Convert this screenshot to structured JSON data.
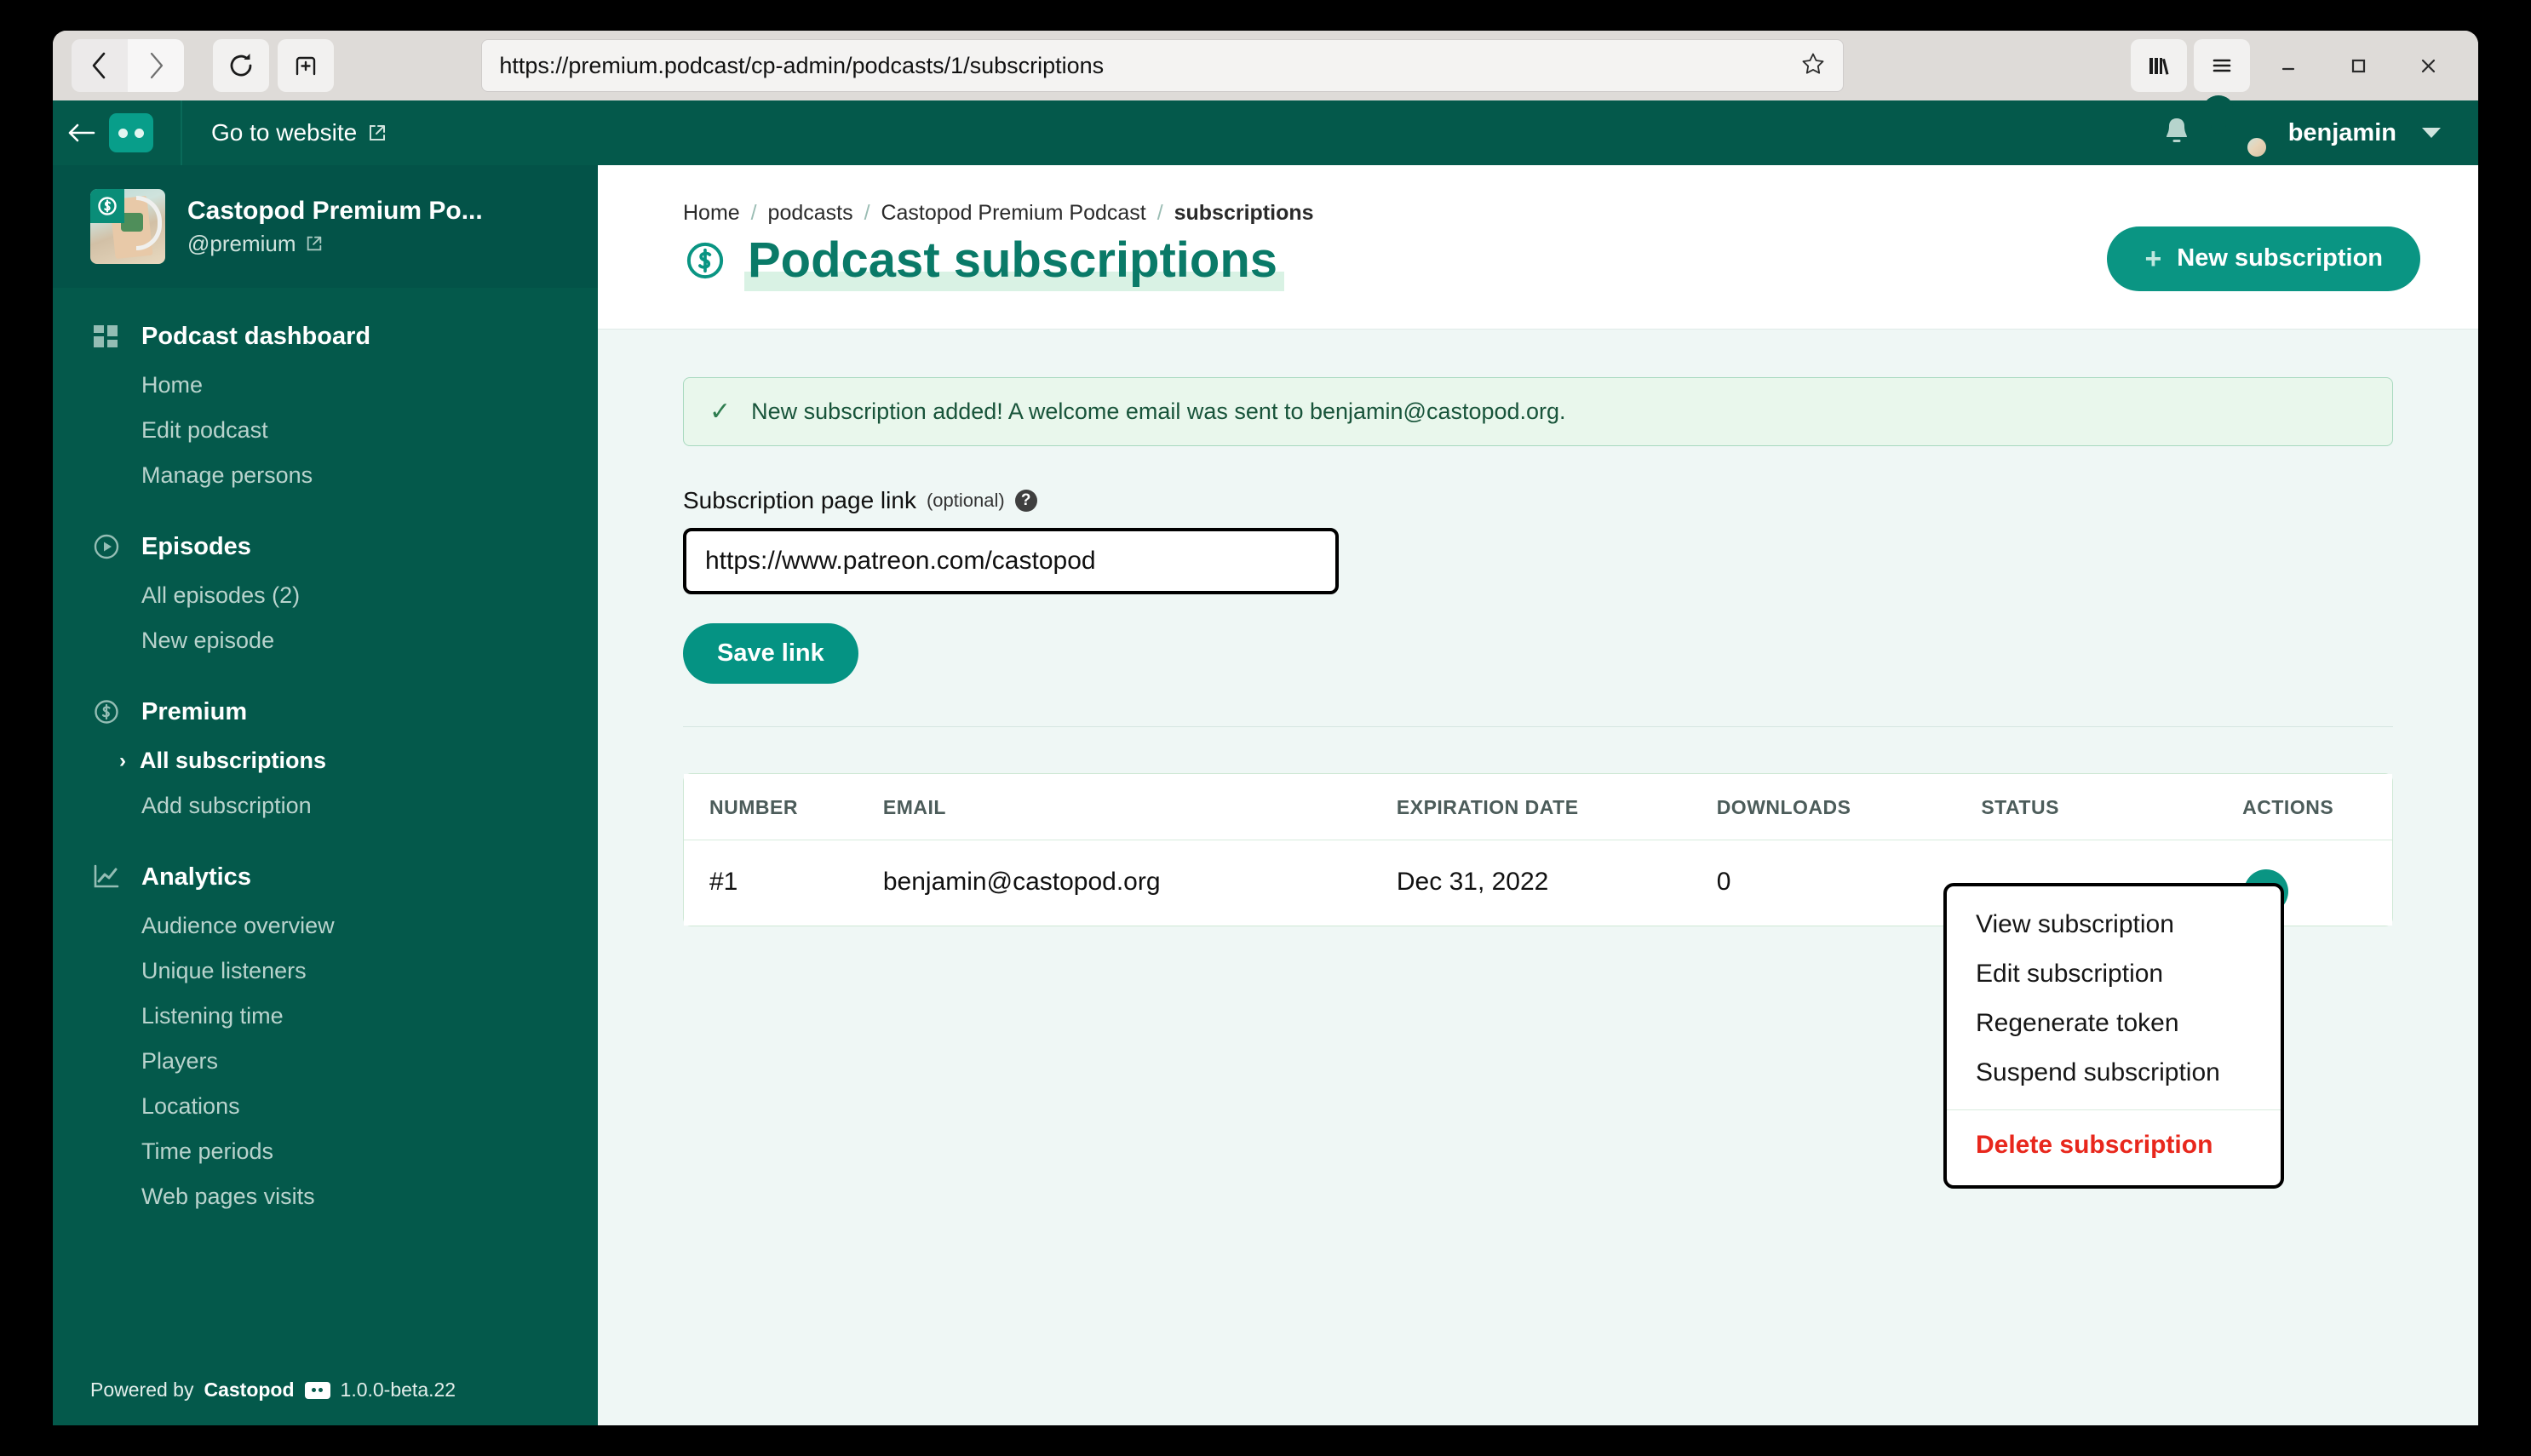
{
  "browser": {
    "url": "https://premium.podcast/cp-admin/podcasts/1/subscriptions",
    "back_icon": "back-arrow-icon",
    "forward_icon": "forward-arrow-icon",
    "reload_icon": "reload-icon",
    "newtab_icon": "new-tab-icon",
    "bookmark_icon": "star-icon",
    "library_icon": "library-icon",
    "menu_icon": "hamburger-menu-icon",
    "minimize_icon": "minimize-icon",
    "maximize_icon": "maximize-icon",
    "close_icon": "close-icon"
  },
  "appbar": {
    "back_label": "←",
    "brand": "castopod-logo",
    "go_to_website": "Go to website",
    "notifications_icon": "bell-icon",
    "username": "benjamin"
  },
  "sidebar": {
    "podcast_title": "Castopod Premium Po...",
    "podcast_handle": "@premium",
    "sections": [
      {
        "label": "Podcast dashboard",
        "icon": "dashboard-grid-icon",
        "items": [
          {
            "label": "Home",
            "active": false
          },
          {
            "label": "Edit podcast",
            "active": false
          },
          {
            "label": "Manage persons",
            "active": false
          }
        ]
      },
      {
        "label": "Episodes",
        "icon": "play-circle-icon",
        "items": [
          {
            "label": "All episodes (2)",
            "active": false
          },
          {
            "label": "New episode",
            "active": false
          }
        ]
      },
      {
        "label": "Premium",
        "icon": "subscription-dollar-icon",
        "items": [
          {
            "label": "All subscriptions",
            "active": true
          },
          {
            "label": "Add subscription",
            "active": false
          }
        ]
      },
      {
        "label": "Analytics",
        "icon": "line-chart-icon",
        "items": [
          {
            "label": "Audience overview",
            "active": false
          },
          {
            "label": "Unique listeners",
            "active": false
          },
          {
            "label": "Listening time",
            "active": false
          },
          {
            "label": "Players",
            "active": false
          },
          {
            "label": "Locations",
            "active": false
          },
          {
            "label": "Time periods",
            "active": false
          },
          {
            "label": "Web pages visits",
            "active": false
          }
        ]
      }
    ],
    "footer": {
      "powered_by": "Powered by",
      "brand": "Castopod",
      "version": "1.0.0-beta.22"
    }
  },
  "page": {
    "breadcrumb": [
      {
        "label": "Home",
        "current": false
      },
      {
        "label": "podcasts",
        "current": false
      },
      {
        "label": "Castopod Premium Podcast",
        "current": false
      },
      {
        "label": "subscriptions",
        "current": true
      }
    ],
    "title": "Podcast subscriptions",
    "title_icon": "subscription-dollar-icon",
    "new_subscription_button": "New subscription",
    "new_subscription_plus": "+"
  },
  "alert": {
    "icon": "check-icon",
    "message": "New subscription added! A welcome email was sent to benjamin@castopod.org."
  },
  "form": {
    "label": "Subscription page link",
    "optional": "(optional)",
    "help_icon": "help-circle-icon",
    "value": "https://www.patreon.com/castopod",
    "placeholder": "https://www.patreon.com/castopod",
    "save_label": "Save link"
  },
  "table": {
    "columns": [
      "NUMBER",
      "EMAIL",
      "EXPIRATION DATE",
      "DOWNLOADS",
      "STATUS",
      "ACTIONS"
    ],
    "rows": [
      {
        "number": "#1",
        "email": "benjamin@castopod.org",
        "expiration_date": "Dec 31, 2022",
        "downloads": "0",
        "status": "",
        "action_icon": "more-actions-icon"
      }
    ]
  },
  "dropdown": {
    "items": [
      {
        "label": "View subscription",
        "danger": false
      },
      {
        "label": "Edit subscription",
        "danger": false
      },
      {
        "label": "Regenerate token",
        "danger": false
      },
      {
        "label": "Suspend subscription",
        "danger": false
      }
    ],
    "danger_item": {
      "label": "Delete subscription",
      "danger": true
    }
  },
  "colors": {
    "brand_dark": "#04594b",
    "brand_teal": "#0a9583",
    "accent_light": "#d9f2e4",
    "danger": "#e8271c",
    "page_bg": "#eff7f5"
  }
}
